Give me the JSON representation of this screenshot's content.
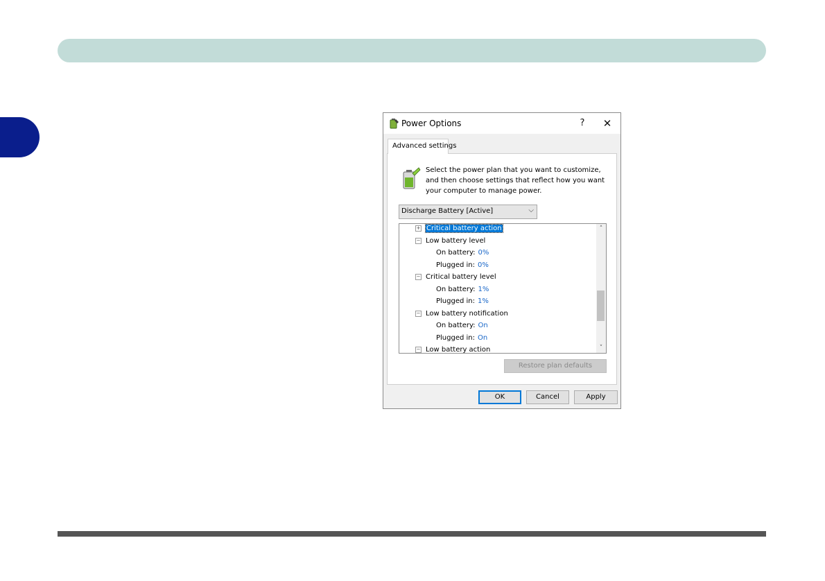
{
  "dialog": {
    "title": "Power Options",
    "help_label": "?",
    "close_label": "✕",
    "tab_label": "Advanced settings",
    "description": "Select the power plan that you want to customize, and then choose settings that reflect how you want your computer to manage power.",
    "plan_select": {
      "value": "Discharge Battery [Active]"
    },
    "tree": [
      {
        "label": "Critical battery action",
        "expander": "+",
        "selected": true
      },
      {
        "label": "Low battery level",
        "expander": "−"
      },
      {
        "label": "On battery:",
        "value": "0%"
      },
      {
        "label": "Plugged in:",
        "value": "0%"
      },
      {
        "label": "Critical battery level",
        "expander": "−"
      },
      {
        "label": "On battery:",
        "value": "1%"
      },
      {
        "label": "Plugged in:",
        "value": "1%"
      },
      {
        "label": "Low battery notification",
        "expander": "−"
      },
      {
        "label": "On battery:",
        "value": "On"
      },
      {
        "label": "Plugged in:",
        "value": "On"
      },
      {
        "label": "Low battery action",
        "expander": "−"
      }
    ],
    "restore_label": "Restore plan defaults",
    "ok_label": "OK",
    "cancel_label": "Cancel",
    "apply_label": "Apply"
  },
  "colors": {
    "header_bar": "#c2dcd8",
    "chapter_tab": "#0a1e8c",
    "selection": "#0078d7",
    "value_text": "#1866c8"
  }
}
